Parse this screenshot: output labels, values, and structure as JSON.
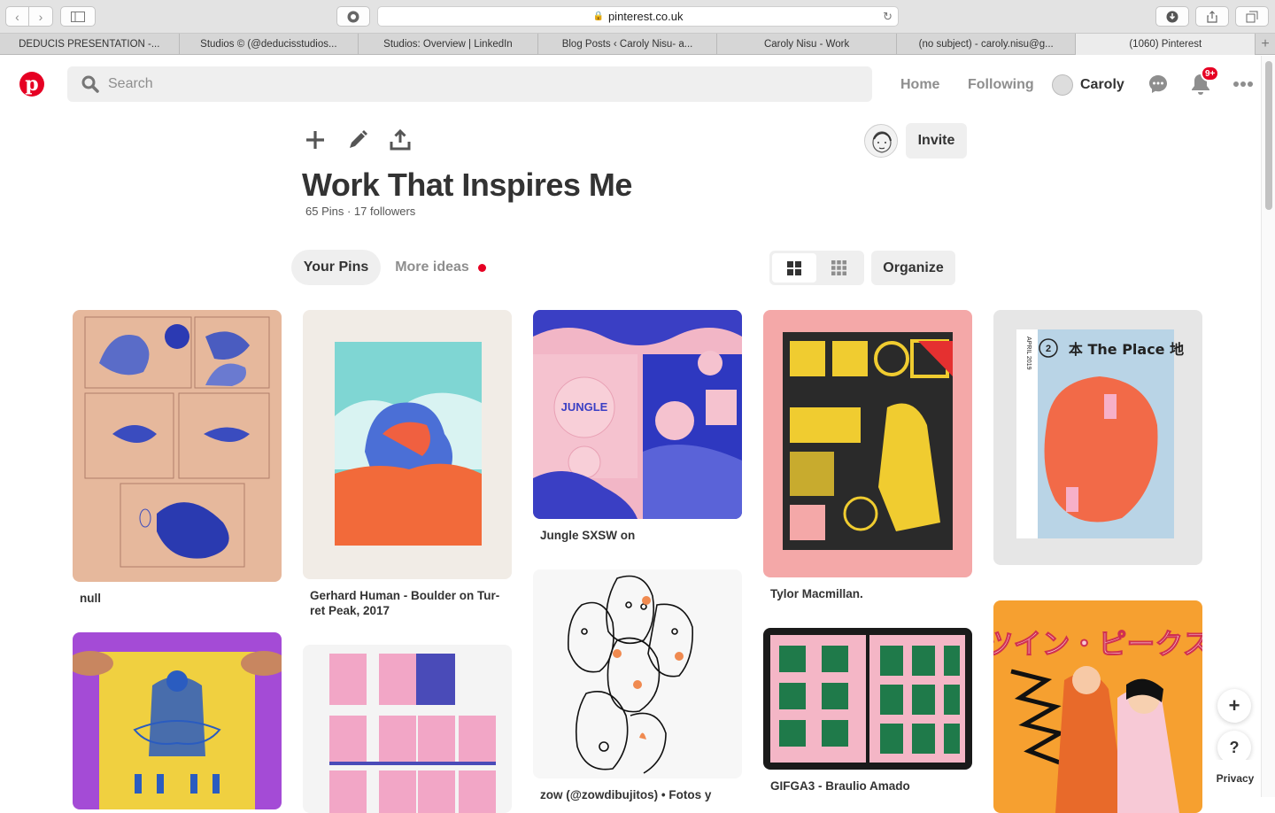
{
  "browser": {
    "url": "pinterest.co.uk",
    "tabs": [
      "DEDUCIS PRESENTATION -...",
      "Studios © (@deducisstudios...",
      "Studios: Overview | LinkedIn",
      "Blog Posts ‹ Caroly Nisu- a...",
      "Caroly Nisu - Work",
      "(no subject) - caroly.nisu@g...",
      "(1060) Pinterest"
    ]
  },
  "header": {
    "search_placeholder": "Search",
    "nav_home": "Home",
    "nav_following": "Following",
    "user_name": "Caroly",
    "notification_badge": "9+"
  },
  "board": {
    "title": "Work That Inspires Me",
    "meta": "65 Pins · 17 followers",
    "invite_label": "Invite",
    "tab_your_pins": "Your Pins",
    "tab_more_ideas": "More ideas",
    "organize_label": "Organize"
  },
  "pins": {
    "p1_title": "null",
    "p2_title": "Gerhard Human - Boulder on Tur-ret Peak, 2017",
    "p3_title": "Jungle SXSW on",
    "p3_art_text": "JUNGLE",
    "p4_title": "Tylor Macmillan.",
    "p5_art_kanji": "本 The Place 地",
    "p5_art_date": "APRIL 2019",
    "p5_art_num": "2",
    "p7_title": "zow (@zowdibujitos) • Fotos y",
    "p8_title": "GIFGA3 - Braulio Amado",
    "p9_art_text": "ツイン・ピークス"
  },
  "footer": {
    "help": "?",
    "privacy": "Privacy"
  },
  "colors": {
    "brand_red": "#e60023",
    "text_dark": "#333333",
    "text_muted": "#8e8e8e",
    "chip_bg": "#efefef"
  }
}
